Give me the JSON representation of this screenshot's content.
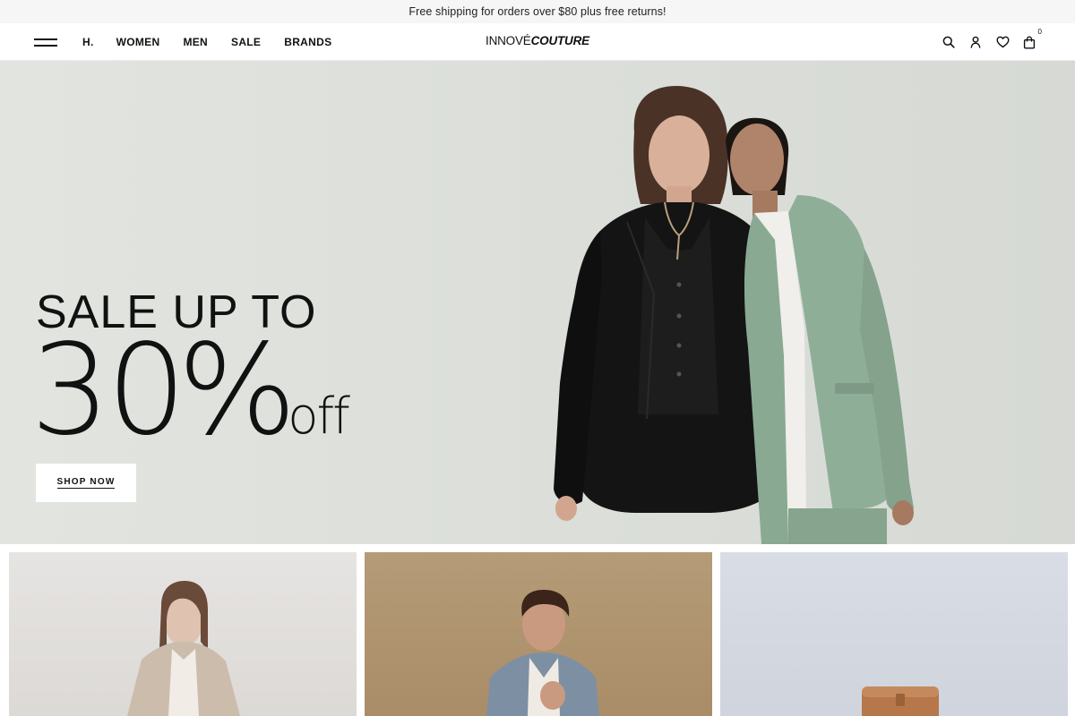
{
  "announcement": {
    "text": "Free shipping for orders over $80 plus free returns!"
  },
  "header": {
    "nav": [
      {
        "label": "H."
      },
      {
        "label": "WOMEN"
      },
      {
        "label": "MEN"
      },
      {
        "label": "SALE"
      },
      {
        "label": "BRANDS"
      }
    ],
    "logo": {
      "part1": "INNOVÉ",
      "part2": "COUTURE"
    },
    "icons": [
      "search-icon",
      "user-icon",
      "heart-icon",
      "bag-icon"
    ],
    "cart_count": "0"
  },
  "hero": {
    "line1": "SALE UP TO",
    "number": "30",
    "percent": "%",
    "off": "off",
    "button_label": "SHOP NOW",
    "colors": {
      "background": "#dcdfda",
      "black_suit": "#141414",
      "green_suit": "#8fae98"
    }
  },
  "categories": [
    {
      "name": "women",
      "bg": "#e0dedb"
    },
    {
      "name": "men",
      "bg": "#b0956f"
    },
    {
      "name": "accessories",
      "bg": "#d4d8e0"
    }
  ]
}
